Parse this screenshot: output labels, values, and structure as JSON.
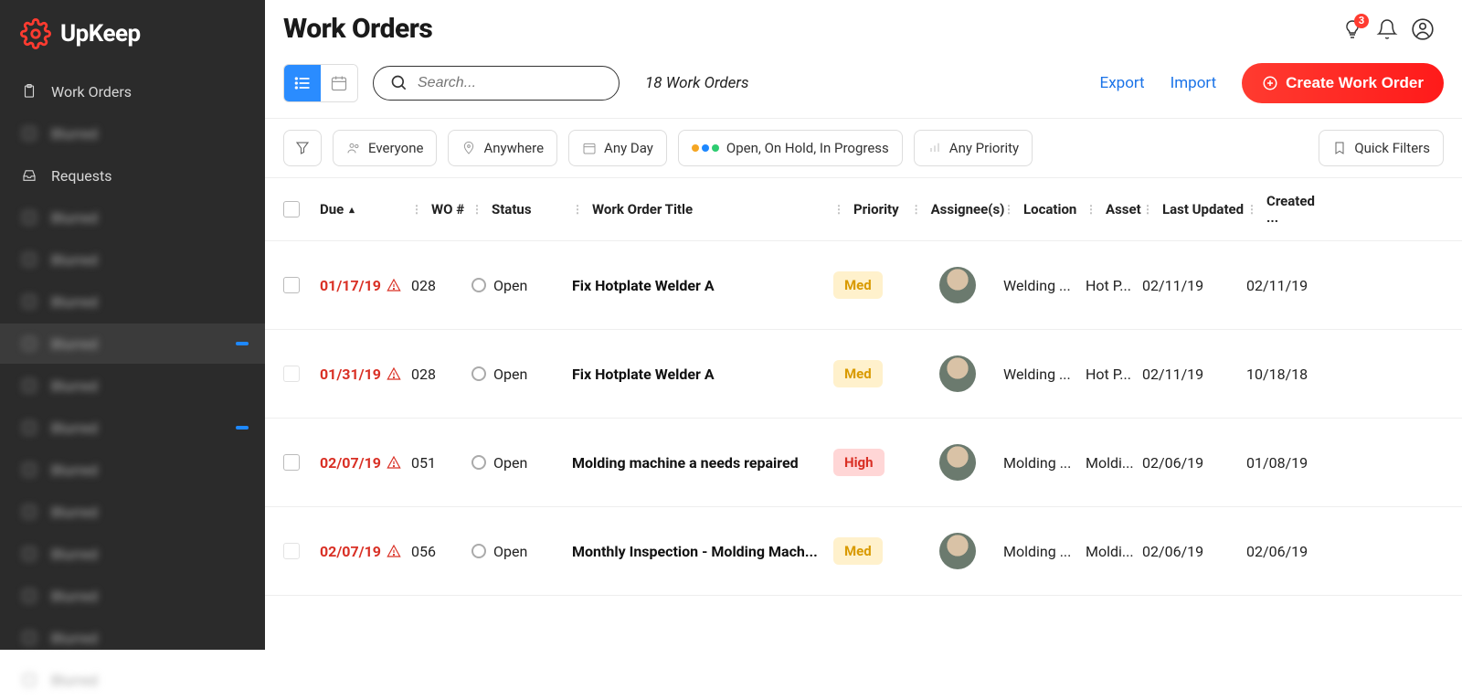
{
  "brand": {
    "name": "UpKeep"
  },
  "sidebar": {
    "items": [
      {
        "label": "Work Orders",
        "icon": "clipboard",
        "active": false,
        "badge": null,
        "blurred": false
      },
      {
        "label": "Blurred",
        "icon": "box",
        "active": false,
        "badge": null,
        "blurred": true
      },
      {
        "label": "Requests",
        "icon": "inbox",
        "active": false,
        "badge": null,
        "blurred": false
      },
      {
        "label": "Blurred",
        "icon": "box",
        "active": false,
        "badge": null,
        "blurred": true
      },
      {
        "label": "Blurred",
        "icon": "box",
        "active": false,
        "badge": null,
        "blurred": true
      },
      {
        "label": "Blurred",
        "icon": "box",
        "active": false,
        "badge": null,
        "blurred": true
      },
      {
        "label": "Blurred",
        "icon": "box",
        "active": true,
        "badge": " ",
        "blurred": true
      },
      {
        "label": "Blurred",
        "icon": "box",
        "active": false,
        "badge": null,
        "blurred": true
      },
      {
        "label": "Blurred",
        "icon": "box",
        "active": false,
        "badge": " ",
        "blurred": true
      },
      {
        "label": "Blurred",
        "icon": "box",
        "active": false,
        "badge": null,
        "blurred": true
      },
      {
        "label": "Blurred",
        "icon": "box",
        "active": false,
        "badge": null,
        "blurred": true
      },
      {
        "label": "Blurred",
        "icon": "box",
        "active": false,
        "badge": null,
        "blurred": true
      },
      {
        "label": "Blurred",
        "icon": "box",
        "active": false,
        "badge": null,
        "blurred": true
      },
      {
        "label": "Blurred",
        "icon": "box",
        "active": false,
        "badge": null,
        "blurred": true
      },
      {
        "label": "Blurred",
        "icon": "box",
        "active": false,
        "badge": null,
        "blurred": true
      }
    ]
  },
  "header": {
    "title": "Work Orders",
    "notif_count": "3"
  },
  "toolbar": {
    "search_placeholder": "Search...",
    "count_text": "18 Work Orders",
    "export_label": "Export",
    "import_label": "Import",
    "create_label": "Create Work Order"
  },
  "filters": {
    "everyone": "Everyone",
    "anywhere": "Anywhere",
    "anyday": "Any Day",
    "status": "Open, On Hold, In Progress",
    "priority": "Any Priority",
    "quick": "Quick Filters"
  },
  "columns": {
    "due": "Due",
    "wo": "WO #",
    "status": "Status",
    "title": "Work Order Title",
    "priority": "Priority",
    "assignee": "Assignee(s)",
    "location": "Location",
    "asset": "Asset",
    "updated": "Last Updated",
    "created": "Created ..."
  },
  "rows": [
    {
      "due": "01/17/19",
      "wo": "028",
      "status": "Open",
      "title": "Fix Hotplate Welder A",
      "priority": "Med",
      "priority_class": "med",
      "location": "Welding ...",
      "asset": "Hot P...",
      "updated": "02/11/19",
      "created": "02/11/19",
      "dim": false
    },
    {
      "due": "01/31/19",
      "wo": "028",
      "status": "Open",
      "title": "Fix Hotplate Welder A",
      "priority": "Med",
      "priority_class": "med",
      "location": "Welding ...",
      "asset": "Hot P...",
      "updated": "02/11/19",
      "created": "10/18/18",
      "dim": true
    },
    {
      "due": "02/07/19",
      "wo": "051",
      "status": "Open",
      "title": "Molding machine a needs repaired",
      "priority": "High",
      "priority_class": "high",
      "location": "Molding ...",
      "asset": "Moldi...",
      "updated": "02/06/19",
      "created": "01/08/19",
      "dim": false
    },
    {
      "due": "02/07/19",
      "wo": "056",
      "status": "Open",
      "title": "Monthly Inspection - Molding Mach...",
      "priority": "Med",
      "priority_class": "med",
      "location": "Molding ...",
      "asset": "Moldi...",
      "updated": "02/06/19",
      "created": "02/06/19",
      "dim": true
    }
  ]
}
